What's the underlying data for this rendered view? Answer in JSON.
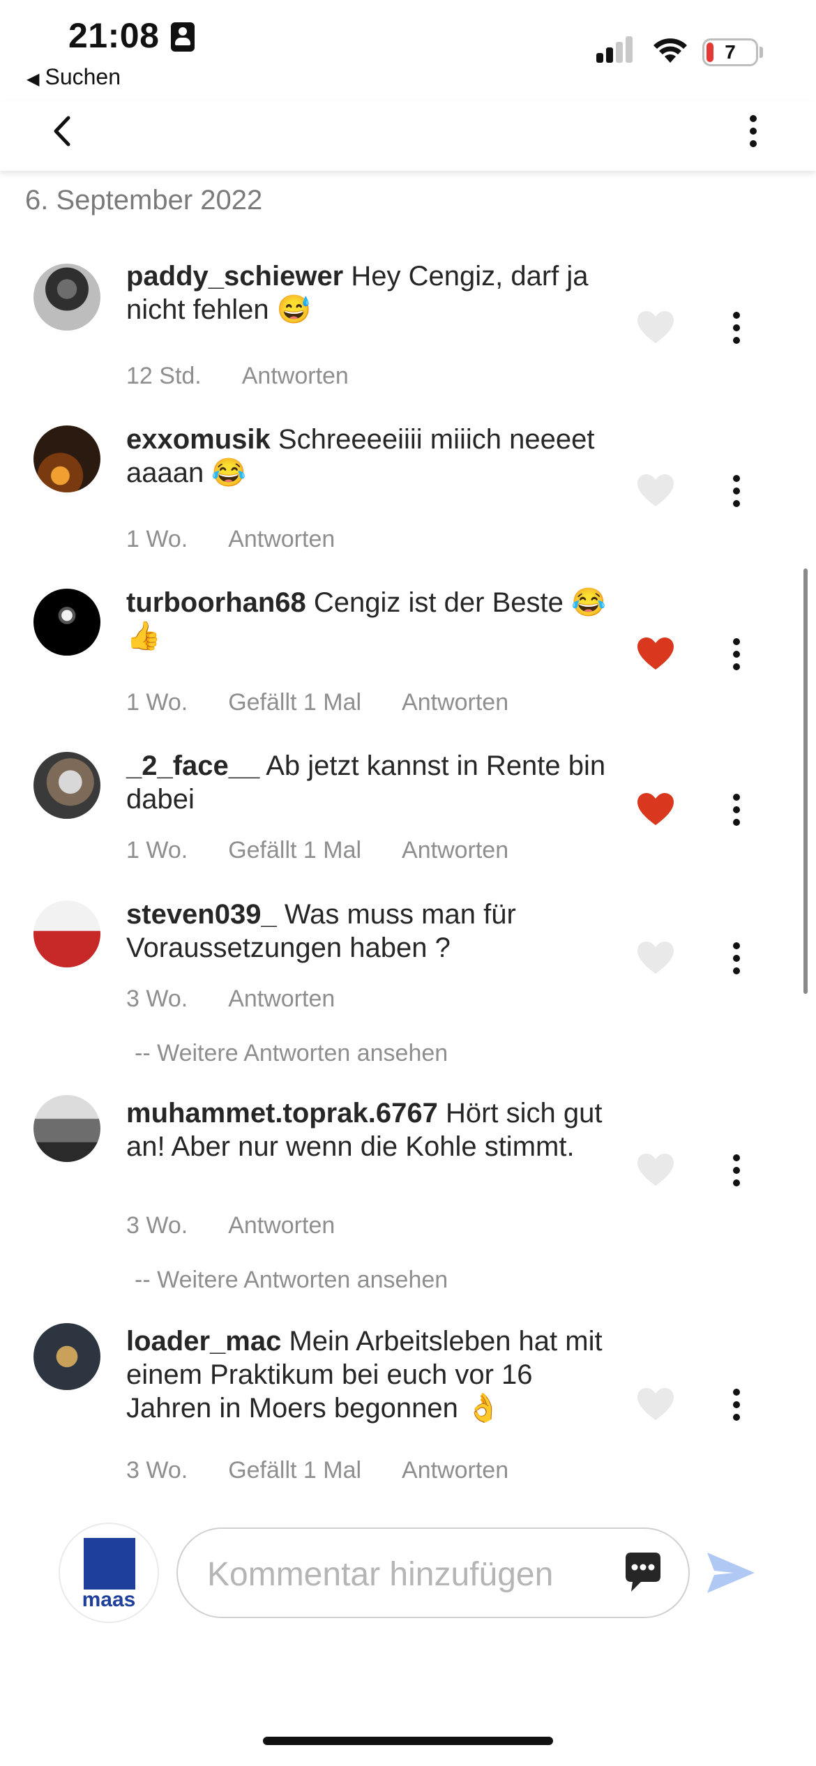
{
  "status_bar": {
    "time": "21:08",
    "back_app": "Suchen",
    "battery": "7"
  },
  "date_header": "6. September 2022",
  "comments": [
    {
      "user": "paddy_schiewer",
      "text": "Hey Cengiz, darf ja nicht fehlen 😅",
      "time": "12 Std.",
      "likes": "",
      "reply": "Antworten",
      "liked": false
    },
    {
      "user": "exxomusik",
      "text": "Schreeeeiiii miiich neeeet aaaan 😂",
      "time": "1 Wo.",
      "likes": "",
      "reply": "Antworten",
      "liked": false
    },
    {
      "user": "turboorhan68",
      "text": "Cengiz ist der Beste 😂👍",
      "time": "1 Wo.",
      "likes": "Gefällt 1 Mal",
      "reply": "Antworten",
      "liked": true
    },
    {
      "user": "_2_face__",
      "text": "Ab jetzt kannst in Rente bin dabei",
      "time": "1 Wo.",
      "likes": "Gefällt 1 Mal",
      "reply": "Antworten",
      "liked": true
    },
    {
      "user": "steven039_",
      "text": "Was muss man für Voraussetzungen haben ?",
      "time": "3 Wo.",
      "likes": "",
      "reply": "Antworten",
      "liked": false,
      "more_replies": "-- Weitere Antworten ansehen"
    },
    {
      "user": "muhammet.toprak.6767",
      "text": "Hört sich gut an! Aber nur wenn die Kohle stimmt.",
      "time": "3 Wo.",
      "likes": "",
      "reply": "Antworten",
      "liked": false,
      "more_replies": "-- Weitere Antworten ansehen"
    },
    {
      "user": "loader_mac",
      "text": "Mein Arbeitsleben hat mit einem Praktikum bei euch  vor 16 Jahren in Moers begonnen 👌",
      "time": "3 Wo.",
      "likes": "Gefällt 1 Mal",
      "reply": "Antworten",
      "liked": false
    }
  ],
  "composer": {
    "avatar_label": "maas",
    "placeholder": "Kommentar hinzufügen"
  },
  "colors": {
    "liked": "#d9381e",
    "unliked": "#e9e9e9",
    "send": "#b0c8f4",
    "brand": "#1e3f9b"
  },
  "icons": [
    "back-arrow-icon",
    "more-vertical-icon",
    "heart-icon",
    "chat-bubble-icon",
    "send-icon"
  ]
}
